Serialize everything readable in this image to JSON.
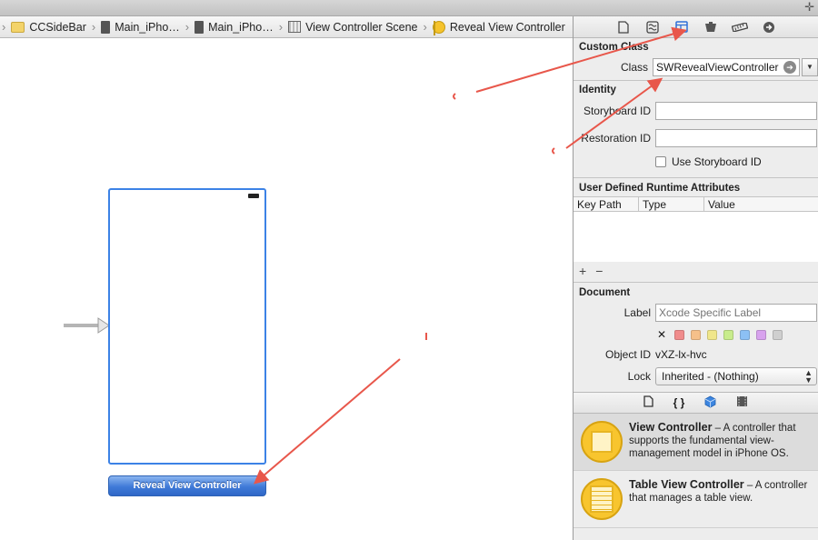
{
  "jumpbar": {
    "crumbs": [
      "CCSideBar",
      "Main_iPho…",
      "Main_iPho…",
      "View Controller Scene",
      "Reveal View Controller"
    ]
  },
  "canvas": {
    "scene_label": "Reveal View Controller"
  },
  "inspector": {
    "custom_class": {
      "title": "Custom Class",
      "class_label": "Class",
      "class_value": "SWRevealViewController"
    },
    "identity": {
      "title": "Identity",
      "storyboard_id_label": "Storyboard ID",
      "storyboard_id_value": "",
      "restoration_id_label": "Restoration ID",
      "restoration_id_value": "",
      "use_storyboard_id_label": "Use Storyboard ID"
    },
    "runtime_attributes": {
      "title": "User Defined Runtime Attributes",
      "columns": [
        "Key Path",
        "Type",
        "Value"
      ]
    },
    "document": {
      "title": "Document",
      "label_label": "Label",
      "label_placeholder": "Xcode Specific Label",
      "swatch_colors": [
        "#f08c8c",
        "#f5c08a",
        "#f0e68a",
        "#c8ec8c",
        "#8cc0f5",
        "#d8a2ee",
        "#cfcfcf"
      ],
      "object_id_label": "Object ID",
      "object_id_value": "vXZ-lx-hvc",
      "lock_label": "Lock",
      "lock_value": "Inherited - (Nothing)"
    },
    "library": {
      "items": [
        {
          "name": "View Controller",
          "description": " – A controller that supports the fundamental view-management model in iPhone OS."
        },
        {
          "name": "Table View Controller",
          "description": " – A controller that manages a table view."
        }
      ]
    }
  },
  "colors": {
    "annotation_arrow": "#e8574b",
    "selection_blue": "#3c82e6",
    "library_yellow": "#f8c52e"
  }
}
